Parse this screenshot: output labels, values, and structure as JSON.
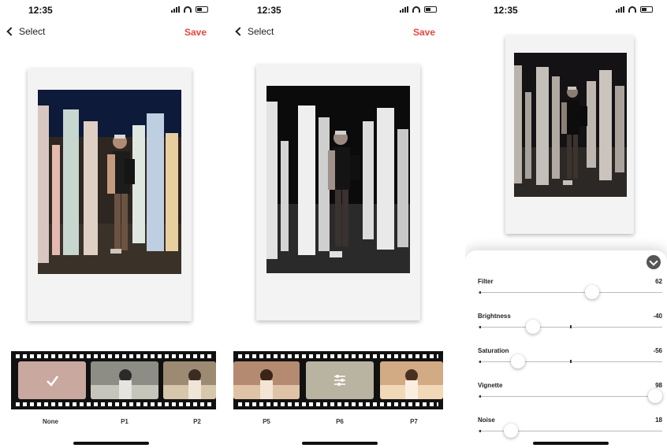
{
  "status": {
    "time": "12:35"
  },
  "nav": {
    "back_label": "Select",
    "save_label": "Save"
  },
  "screen1": {
    "filters": [
      {
        "label": "None",
        "selected": true,
        "icon": "checkmark-icon"
      },
      {
        "label": "P1",
        "selected": false
      },
      {
        "label": "P2",
        "selected": false
      }
    ]
  },
  "screen2": {
    "filters": [
      {
        "label": "P5",
        "selected": false
      },
      {
        "label": "P6",
        "selected": true,
        "icon": "sliders-icon"
      },
      {
        "label": "P7",
        "selected": false
      }
    ]
  },
  "screen3": {
    "adjustments": [
      {
        "label": "Filter",
        "value": "62",
        "level": 0.62
      },
      {
        "label": "Brightness",
        "value": "-40",
        "level": 0.3
      },
      {
        "label": "Saturation",
        "value": "-56",
        "level": 0.22
      },
      {
        "label": "Vignette",
        "value": "98",
        "level": 0.98
      },
      {
        "label": "Noise",
        "value": "18",
        "level": 0.18
      }
    ]
  },
  "colors": {
    "accent": "#e8473f",
    "film": "#111111",
    "selected_none": "#c9a8a0",
    "selected_p6": "#b9b3a2"
  }
}
